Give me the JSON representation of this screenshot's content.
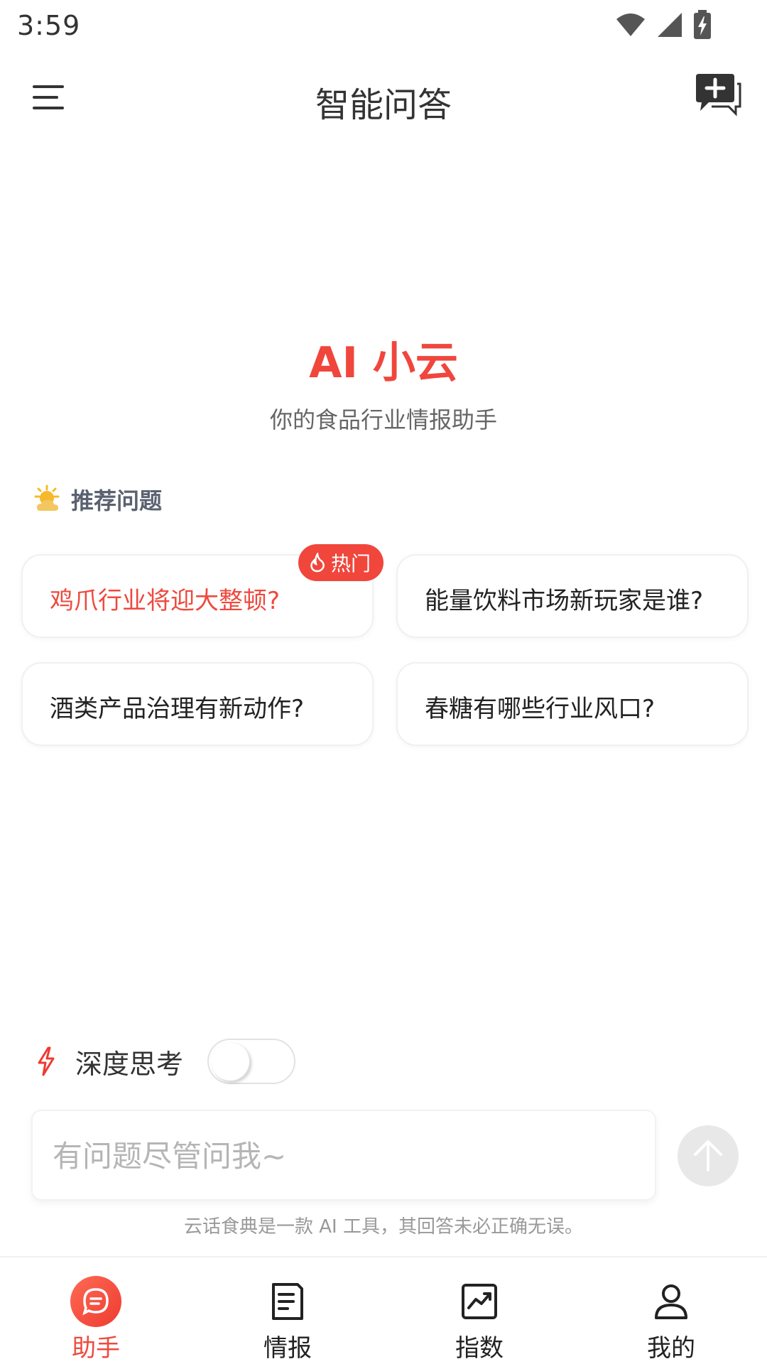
{
  "status_bar": {
    "time": "3:59",
    "icons": [
      "wifi-icon",
      "signal-icon",
      "battery-charging-icon"
    ]
  },
  "header": {
    "title": "智能问答",
    "menu_icon": "menu-icon",
    "new_chat_icon": "new-chat-icon"
  },
  "hero": {
    "title": "AI 小云",
    "subtitle": "你的食品行业情报助手"
  },
  "recommend": {
    "title": "推荐问题",
    "icon": "sun-cloud-icon",
    "questions": [
      {
        "text": "鸡爪行业将迎大整顿?",
        "hot": true,
        "badge": "热门"
      },
      {
        "text": "能量饮料市场新玩家是谁?",
        "hot": false
      },
      {
        "text": "酒类产品治理有新动作?",
        "hot": false
      },
      {
        "text": "春糖有哪些行业风口?",
        "hot": false
      }
    ]
  },
  "deep_think": {
    "label": "深度思考",
    "enabled": false
  },
  "input": {
    "placeholder": "有问题尽管问我~"
  },
  "disclaimer": "云话食典是一款 AI 工具，其回答未必正确无误。",
  "bottom_nav": {
    "items": [
      {
        "label": "助手",
        "icon": "chat-bubble-icon",
        "active": true
      },
      {
        "label": "情报",
        "icon": "document-icon",
        "active": false
      },
      {
        "label": "指数",
        "icon": "trend-chart-icon",
        "active": false
      },
      {
        "label": "我的",
        "icon": "user-icon",
        "active": false
      }
    ]
  },
  "colors": {
    "accent": "#f0463c",
    "text": "#222222",
    "muted": "#999999"
  }
}
